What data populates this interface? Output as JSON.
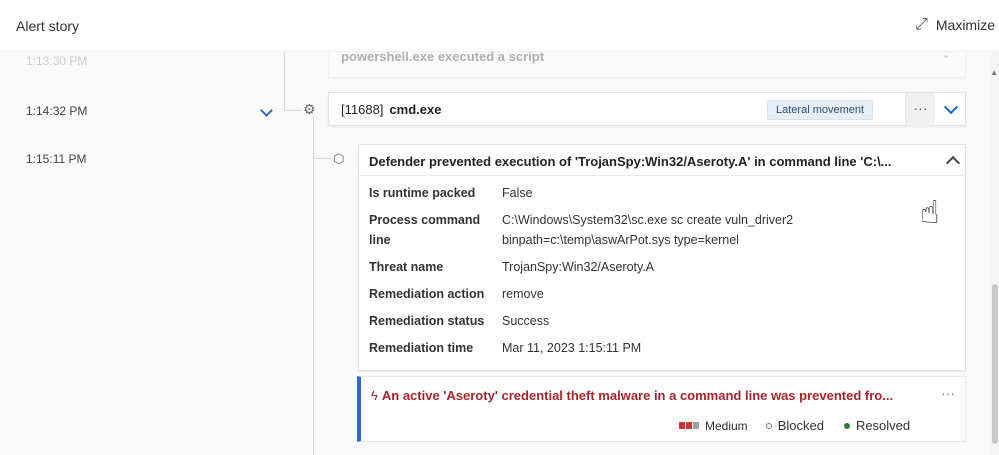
{
  "header": {
    "title": "Alert story",
    "maximize_label": "Maximize"
  },
  "timeline": {
    "times": [
      "1:13:30 PM",
      "1:14:32 PM",
      "1:15:11 PM"
    ]
  },
  "prev_event": {
    "text": "powershell.exe executed a script"
  },
  "process": {
    "pid": "[11688]",
    "name": "cmd.exe",
    "badge": "Lateral movement",
    "more": "···"
  },
  "detail": {
    "title": "Defender prevented execution of 'TrojanSpy:Win32/Aseroty.A' in command line 'C:\\...",
    "rows": [
      {
        "key": "Is runtime packed",
        "value": "False"
      },
      {
        "key": "Process command line",
        "value": "C:\\Windows\\System32\\sc.exe sc create vuln_driver2 binpath=c:\\temp\\aswArPot.sys type=kernel"
      },
      {
        "key": "Threat name",
        "value": "TrojanSpy:Win32/Aseroty.A"
      },
      {
        "key": "Remediation action",
        "value": "remove"
      },
      {
        "key": "Remediation status",
        "value": "Success"
      },
      {
        "key": "Remediation time",
        "value": "Mar 11, 2023 1:15:11 PM"
      }
    ]
  },
  "alert": {
    "title": "An active 'Aseroty' credential theft malware in a command line was prevented fro...",
    "more": "···",
    "severity": "Medium",
    "detection_status": "Blocked",
    "status": "Resolved",
    "colors": {
      "severity_active": "#d13438",
      "severity_inactive": "#a0a0a0",
      "resolved": "#2e7d32",
      "accent": "#2e6cc1"
    }
  }
}
